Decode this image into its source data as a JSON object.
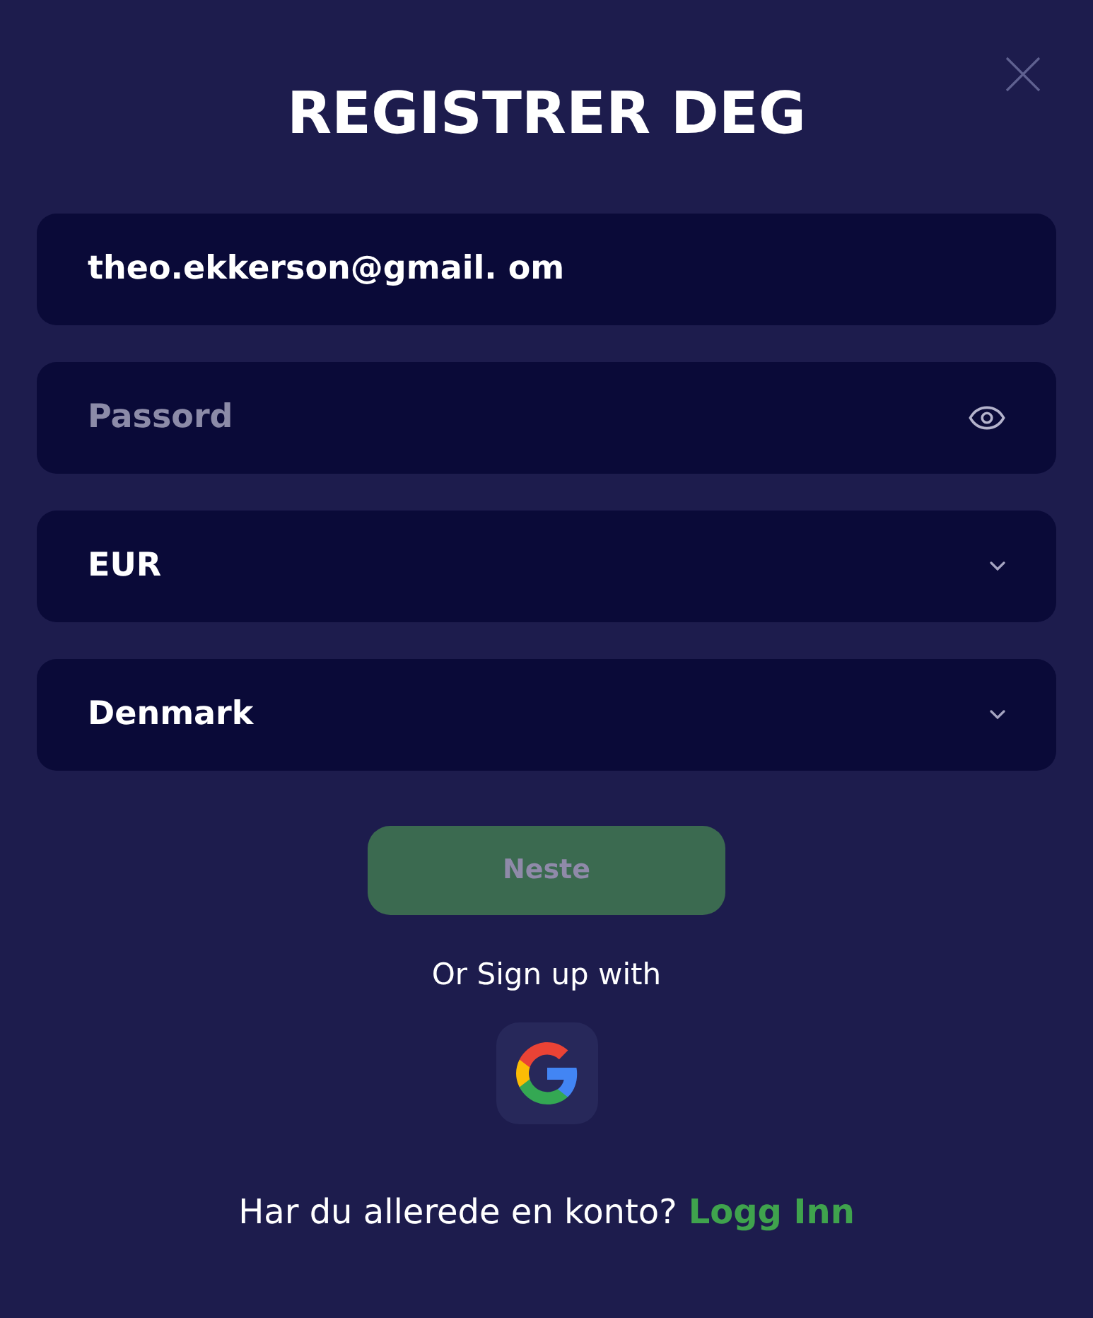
{
  "dialog": {
    "title": "REGISTRER DEG"
  },
  "fields": [
    {
      "kind": "email",
      "value": "theo.ekkerson@gmail. om"
    },
    {
      "kind": "password",
      "placeholder": "Passord"
    },
    {
      "kind": "select",
      "value": "EUR"
    },
    {
      "kind": "select",
      "value": "Denmark"
    }
  ],
  "submit": {
    "label": "Neste",
    "disabled": true
  },
  "social": {
    "label": "Or Sign up with"
  },
  "footer": {
    "text": "Har du allerede en konto?",
    "link": "Logg Inn"
  }
}
